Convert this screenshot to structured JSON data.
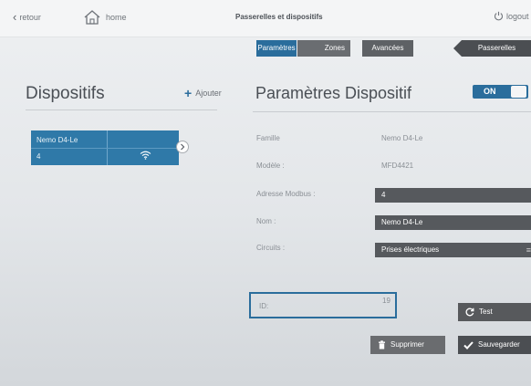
{
  "topbar": {
    "back_label": "retour",
    "home_label": "home",
    "title": "Passerelles et dispositifs",
    "logout_label": "logout"
  },
  "tabs": {
    "params": "Paramètres",
    "zones": "Zones",
    "advanced": "Avancées",
    "gateways": "Passerelles"
  },
  "devices": {
    "title": "Dispositifs",
    "add_label": "Ajouter",
    "card": {
      "name": "Nemo D4-Le",
      "number": "4"
    }
  },
  "params": {
    "title": "Paramètres Dispositif",
    "toggle": "ON",
    "famille_label": "Famille",
    "famille_value": "Nemo D4-Le",
    "modele_label": "Modèle :",
    "modele_value": "MFD4421",
    "adresse_label": "Adresse Modbus :",
    "adresse_value": "4",
    "nom_label": "Nom :",
    "nom_value": "Nemo D4-Le",
    "circuits_label": "Circuits :",
    "circuits_value": "Prises électriques",
    "id_label": "ID:",
    "id_value": "19"
  },
  "buttons": {
    "test": "Test",
    "delete": "Supprimer",
    "save": "Sauvegarder"
  },
  "colors": {
    "accent": "#2a6d9c",
    "card": "#2f79a8",
    "field": "#56595d"
  }
}
